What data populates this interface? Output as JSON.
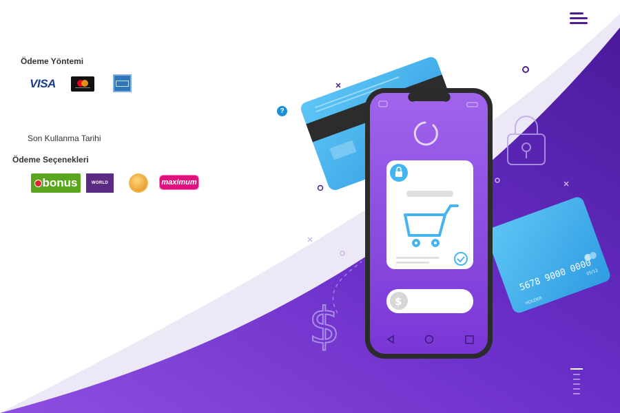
{
  "menu": {
    "icon": "hamburger-menu-icon"
  },
  "payment_method": {
    "title": "Ödeme Yöntemi",
    "logos": [
      "VISA",
      "mastercard-logo",
      "american-express-logo"
    ]
  },
  "expiry": {
    "label": "Son Kullanma Tarihi"
  },
  "payment_options": {
    "title": "Ödeme Seçenekleri",
    "logos": {
      "bonus": "bonus",
      "world": "WORLD",
      "paraf": "paraf-logo",
      "maximum": "maximum"
    }
  },
  "help": {
    "label": "?"
  },
  "illustration": {
    "card_number": "5678 9000 0000",
    "card_expiry": "05/12",
    "card_holder": "HOLDER",
    "currency_symbol": "$"
  },
  "colors": {
    "purple_dark": "#4b1e92",
    "purple_mid": "#7b3cd8",
    "card_blue": "#45b5f0",
    "help_blue": "#1d8fd6"
  }
}
